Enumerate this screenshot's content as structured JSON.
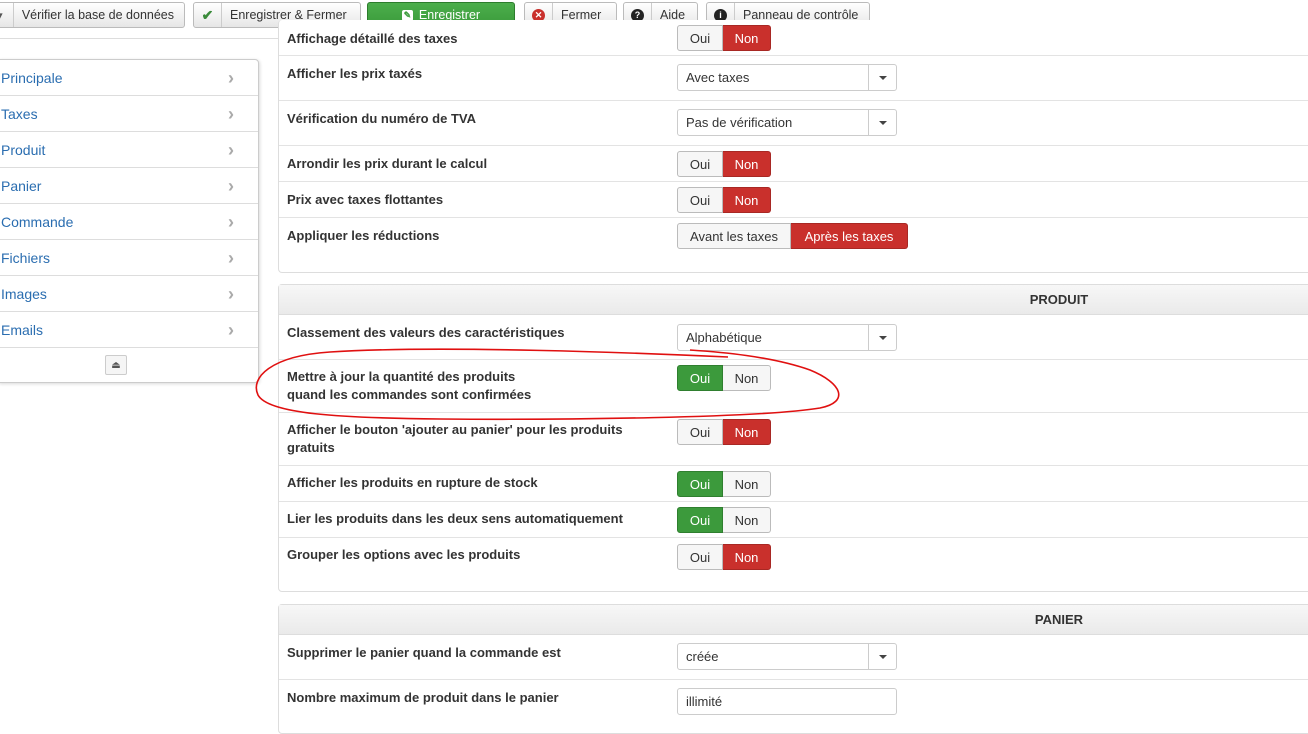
{
  "toolbar": {
    "verify_db": "Vérifier la base de données",
    "save_close": "Enregistrer & Fermer",
    "save": "Enregistrer",
    "close": "Fermer",
    "help": "Aide",
    "control_panel": "Panneau de contrôle"
  },
  "sidebar": {
    "items": [
      {
        "label": "Principale"
      },
      {
        "label": "Taxes"
      },
      {
        "label": "Produit"
      },
      {
        "label": "Panier"
      },
      {
        "label": "Commande"
      },
      {
        "label": "Fichiers"
      },
      {
        "label": "Images"
      },
      {
        "label": "Emails"
      }
    ]
  },
  "taxes": {
    "cut_label": "Affichage détaillé des taxes",
    "cut_no": "Non",
    "display_prices": {
      "label": "Afficher les prix taxés",
      "value": "Avec taxes"
    },
    "vat_check": {
      "label": "Vérification du numéro de TVA",
      "value": "Pas de vérification"
    },
    "round_prices": {
      "label": "Arrondir les prix durant le calcul",
      "yes": "Oui",
      "no": "Non",
      "selected": "Non"
    },
    "floating_tax": {
      "label": "Prix avec taxes flottantes",
      "yes": "Oui",
      "no": "Non",
      "selected": "Non"
    },
    "discounts": {
      "label": "Appliquer les réductions",
      "before": "Avant les taxes",
      "after": "Après les taxes",
      "selected": "Après les taxes"
    }
  },
  "produit": {
    "title": "PRODUIT",
    "characteristics_sort": {
      "label": "Classement des valeurs des caractéristiques",
      "value": "Alphabétique"
    },
    "update_qty": {
      "label1": "Mettre à jour la quantité des produits",
      "label2": "quand les commandes sont confirmées",
      "yes": "Oui",
      "no": "Non",
      "selected": "Oui"
    },
    "free_cart_button": {
      "label1": "Afficher le bouton 'ajouter au panier' pour les produits",
      "label2": "gratuits",
      "yes": "Oui",
      "no": "Non",
      "selected": "Non"
    },
    "out_of_stock": {
      "label": "Afficher les produits en rupture de stock",
      "yes": "Oui",
      "no": "Non",
      "selected": "Oui"
    },
    "link_both": {
      "label": "Lier les produits dans les deux sens automatiquement",
      "yes": "Oui",
      "no": "Non",
      "selected": "Oui"
    },
    "group_options": {
      "label": "Grouper les options avec les produits",
      "yes": "Oui",
      "no": "Non",
      "selected": "Non"
    }
  },
  "panier": {
    "title": "PANIER",
    "delete_cart": {
      "label": "Supprimer le panier quand la commande est",
      "value": "créée"
    },
    "max_products": {
      "label": "Nombre maximum de produit dans le panier",
      "value": "illimité"
    }
  },
  "colors": {
    "green": "#3c9a3c",
    "red": "#c9302c",
    "annotation": "#e01010",
    "link": "#2a6db0"
  }
}
